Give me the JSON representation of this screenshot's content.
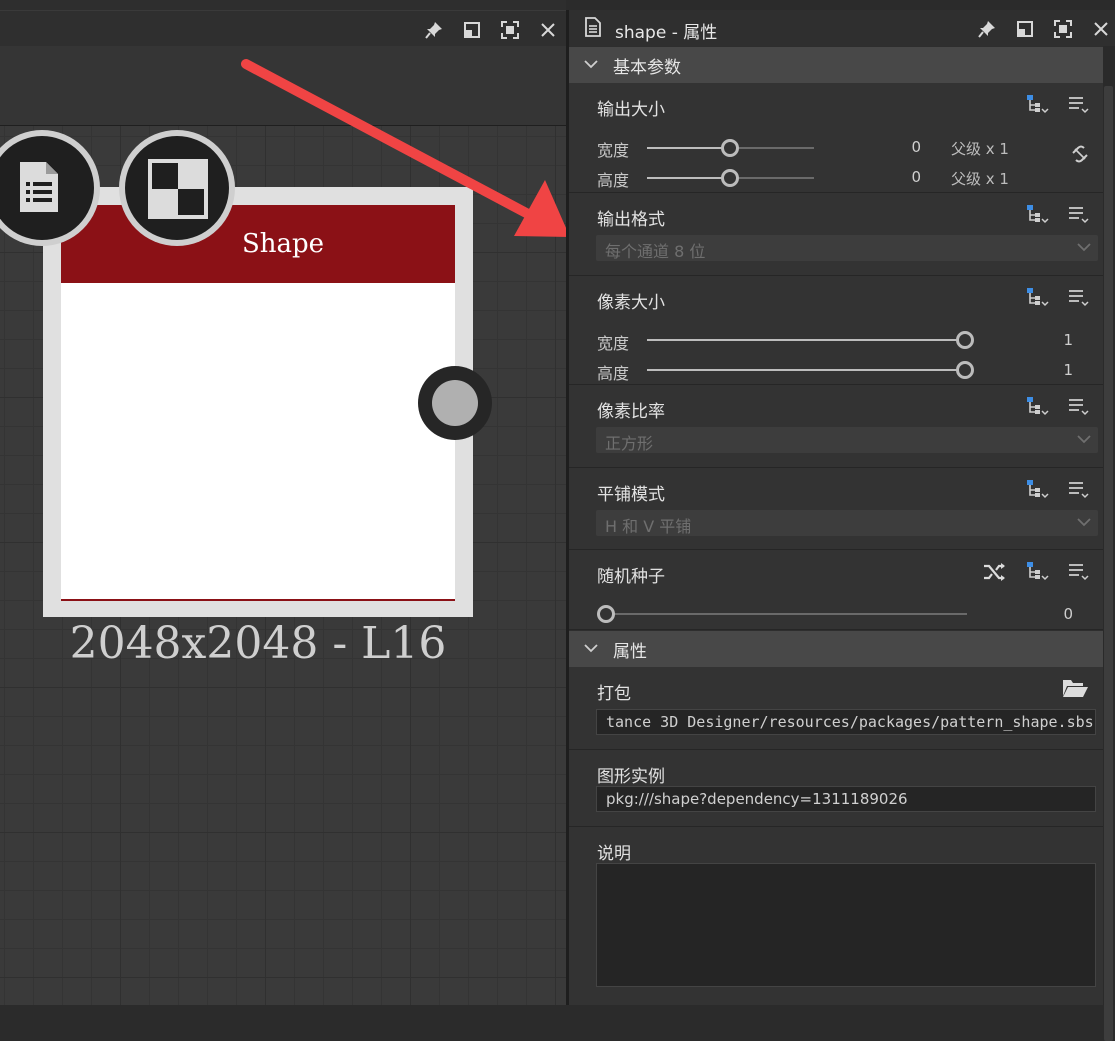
{
  "graph": {
    "node": {
      "title": "Shape",
      "caption": "2048x2048 - L16",
      "header_color": "#8b1116"
    }
  },
  "annotation": {
    "arrow_color": "#f04444"
  },
  "props_panel": {
    "title": "shape - 属性",
    "sections": {
      "basic": "基本参数",
      "attributes": "属性"
    },
    "output_size": {
      "label": "输出大小",
      "width_label": "宽度",
      "width_value": "0",
      "width_parent": "父级 x 1",
      "height_label": "高度",
      "height_value": "0",
      "height_parent": "父级 x 1"
    },
    "output_format": {
      "label": "输出格式",
      "value": "每个通道 8 位"
    },
    "pixel_size": {
      "label": "像素大小",
      "width_label": "宽度",
      "width_value": "1",
      "height_label": "高度",
      "height_value": "1"
    },
    "pixel_ratio": {
      "label": "像素比率",
      "value": "正方形"
    },
    "tiling_mode": {
      "label": "平铺模式",
      "value": "H 和 V 平铺"
    },
    "random_seed": {
      "label": "随机种子",
      "value": "0"
    },
    "package": {
      "label": "打包",
      "value": "tance 3D Designer/resources/packages/pattern_shape.sbs"
    },
    "graph_instance": {
      "label": "图形实例",
      "value": "pkg:///shape?dependency=1311189026"
    },
    "description": {
      "label": "说明",
      "value": ""
    },
    "accent_color": "#3d8ee6"
  }
}
